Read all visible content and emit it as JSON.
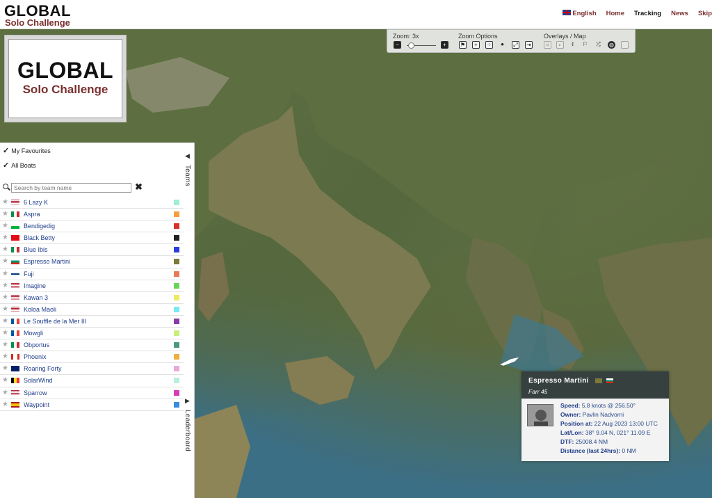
{
  "header": {
    "brand_line1": "GLOBAL",
    "brand_line2": "Solo Challenge",
    "nav": [
      {
        "label": "English",
        "icon": "uk-flag-icon"
      },
      {
        "label": "Home"
      },
      {
        "label": "Tracking"
      },
      {
        "label": "News"
      },
      {
        "label": "Skip"
      }
    ]
  },
  "logo": {
    "line1": "GLOBAL",
    "line2": "Solo Challenge"
  },
  "toolbar": {
    "zoom_label": "Zoom: 3x",
    "zoom_options_label": "Zoom Options",
    "overlays_label": "Overlays / Map"
  },
  "sidebar": {
    "my_favourites": "My Favourites",
    "all_boats": "All Boats",
    "search_placeholder": "Search by team name",
    "teams_tab": "Teams",
    "leaderboard_tab": "Leaderboard",
    "teams": [
      {
        "name": "6 Lazy K",
        "flag": "us",
        "color": "#9ef0d0"
      },
      {
        "name": "Aspra",
        "flag": "it",
        "color": "#f5a03c"
      },
      {
        "name": "Bendigedig",
        "flag": "wales",
        "color": "#d9302a"
      },
      {
        "name": "Black Betty",
        "flag": "tr",
        "color": "#222222"
      },
      {
        "name": "Blue Ibis",
        "flag": "it",
        "color": "#2b3de0"
      },
      {
        "name": "Espresso Martini",
        "flag": "bg",
        "color": "#7a7a3c"
      },
      {
        "name": "Fuji",
        "flag": "fi",
        "color": "#e87a5a"
      },
      {
        "name": "Imagine",
        "flag": "us",
        "color": "#6ad45a"
      },
      {
        "name": "Kawan 3",
        "flag": "us",
        "color": "#f0ea60"
      },
      {
        "name": "Koloa Maoli",
        "flag": "us",
        "color": "#7ae8f5"
      },
      {
        "name": "Le Souffle de la Mer III",
        "flag": "fr",
        "color": "#8a3aa8"
      },
      {
        "name": "Mowgli",
        "flag": "fr",
        "color": "#c8f07a"
      },
      {
        "name": "Obportus",
        "flag": "it",
        "color": "#4a9a7a"
      },
      {
        "name": "Phoenix",
        "flag": "ca",
        "color": "#f0b040"
      },
      {
        "name": "Roaring Forty",
        "flag": "au",
        "color": "#e8a8d8"
      },
      {
        "name": "SolarWind",
        "flag": "be",
        "color": "#b8f0d8"
      },
      {
        "name": "Sparrow",
        "flag": "us",
        "color": "#d83ab8"
      },
      {
        "name": "Waypoint",
        "flag": "es",
        "color": "#3a8ae0"
      }
    ]
  },
  "popup": {
    "boat_name": "Espresso Martini",
    "model": "Farr 45",
    "speed_label": "Speed:",
    "speed": "5.8 knots @ 256.50°",
    "owner_label": "Owner:",
    "owner": "Pavlin Nadvorni",
    "position_label": "Position at:",
    "position": "22 Aug 2023 13:00 UTC",
    "latlon_label": "Lat/Lon:",
    "latlon": "38° 9.04 N, 021° 11.09 E",
    "dtf_label": "DTF:",
    "dtf": "25008.4 NM",
    "dist_label": "Distance (last 24hrs):",
    "dist": "0 NM"
  }
}
